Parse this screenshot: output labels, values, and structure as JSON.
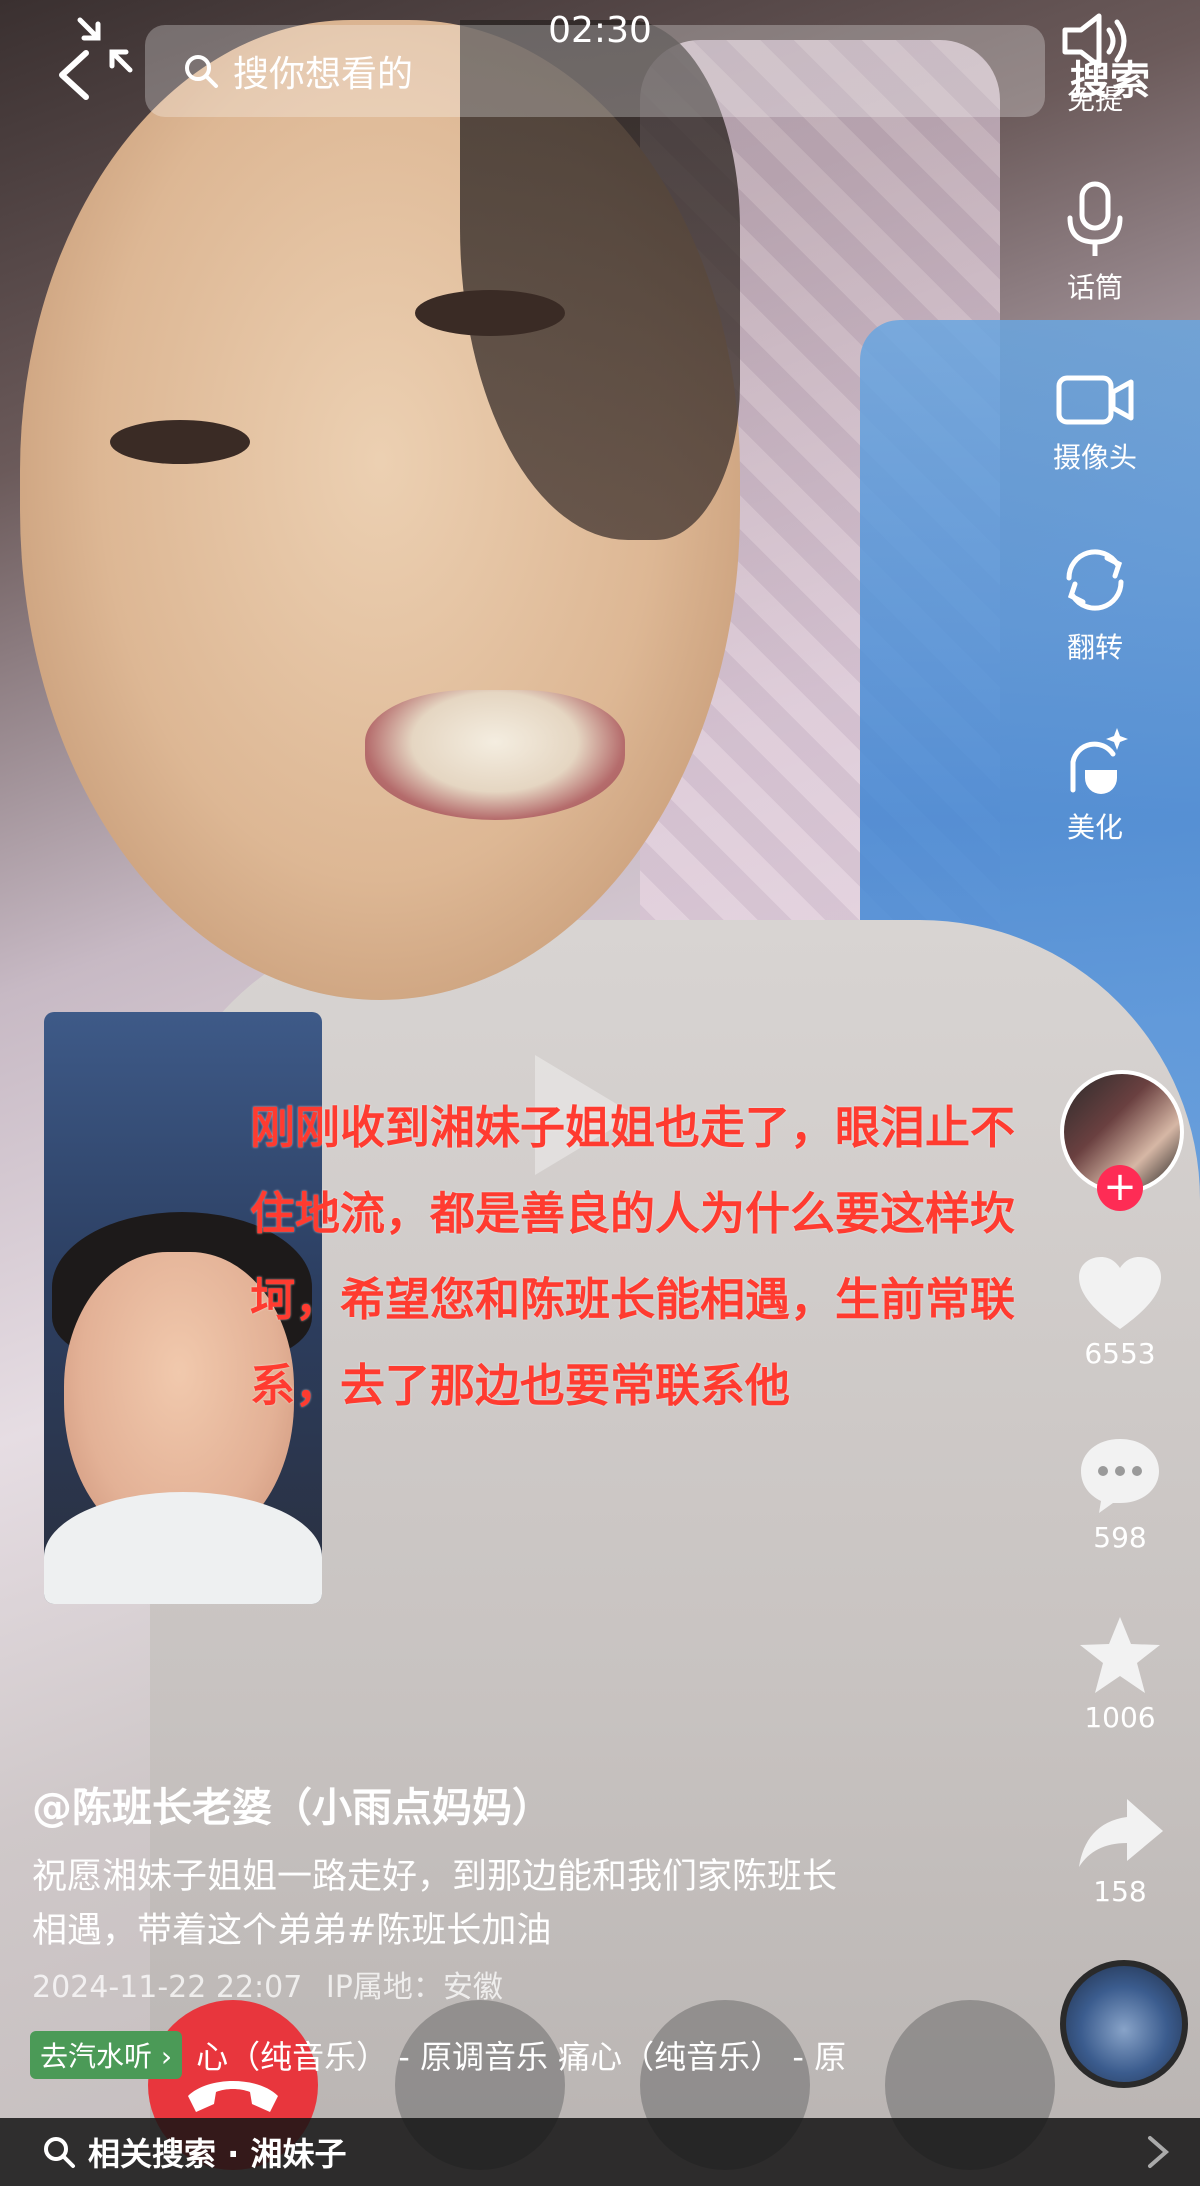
{
  "status": {
    "time": "02:30"
  },
  "search": {
    "placeholder": "搜你想看的",
    "button_label": "搜索"
  },
  "toolbar": [
    {
      "label": "免提",
      "icon": "speaker-icon"
    },
    {
      "label": "话筒",
      "icon": "microphone-icon"
    },
    {
      "label": "摄像头",
      "icon": "camera-icon"
    },
    {
      "label": "翻转",
      "icon": "flip-icon"
    },
    {
      "label": "美化",
      "icon": "beautify-icon"
    }
  ],
  "caption": {
    "lines": [
      "刚刚收到湘妹子姐姐也走了，眼泪止不",
      "住地流，都是善良的人为什么要这样坎",
      "坷，希望您和陈班长能相遇，生前常联",
      "系，去了那边也要常联系他"
    ]
  },
  "actions": {
    "likes": "6553",
    "comments": "598",
    "favorites": "1006",
    "shares": "158"
  },
  "post": {
    "username": "@陈班长老婆（小雨点妈妈）",
    "description_line1": "祝愿湘妹子姐姐一路走好，到那边能和我们家陈班长",
    "description_line2": "相遇，带着这个弟弟#陈班长加油",
    "date": "2024-11-22 22:07",
    "ip_location": "IP属地：安徽"
  },
  "music": {
    "chip": "去汽水听 ›",
    "track_text": "心（纯音乐） - 原调音乐    痛心（纯音乐） - 原"
  },
  "related_search": {
    "label": "相关搜索 · 湘妹子"
  },
  "colors": {
    "caption_red": "#ff3b30",
    "hangup_red": "#e8363d",
    "follow_pink": "#fe2c55"
  }
}
